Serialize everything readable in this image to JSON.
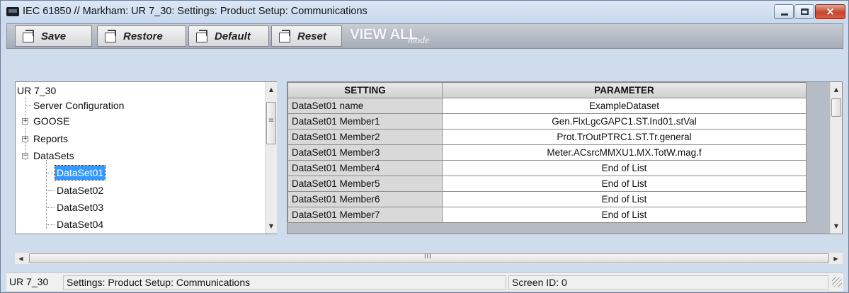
{
  "window": {
    "title": "IEC 61850 // Markham: UR 7_30: Settings: Product Setup: Communications",
    "close_glyph": "×"
  },
  "toolbar": {
    "save_label": "Save",
    "restore_label": "Restore",
    "default_label": "Default",
    "reset_label": "Reset",
    "view_all": "VIEW ALL",
    "view_all_mode": "mode"
  },
  "tree": {
    "root": "UR 7_30",
    "items": [
      {
        "label": "Server Configuration",
        "toggle": ""
      },
      {
        "label": "GOOSE",
        "toggle": "+"
      },
      {
        "label": "Reports",
        "toggle": "+"
      },
      {
        "label": "DataSets",
        "toggle": "−"
      },
      {
        "label": "DataSet01",
        "toggle": "",
        "selected": true
      },
      {
        "label": "DataSet02",
        "toggle": ""
      },
      {
        "label": "DataSet03",
        "toggle": ""
      },
      {
        "label": "DataSet04",
        "toggle": ""
      }
    ]
  },
  "grid": {
    "columns": [
      "SETTING",
      "PARAMETER"
    ],
    "rows": [
      {
        "setting": "DataSet01 name",
        "parameter": "ExampleDataset"
      },
      {
        "setting": "DataSet01 Member1",
        "parameter": "Gen.FlxLgcGAPC1.ST.Ind01.stVal"
      },
      {
        "setting": "DataSet01 Member2",
        "parameter": "Prot.TrOutPTRC1.ST.Tr.general"
      },
      {
        "setting": "DataSet01 Member3",
        "parameter": "Meter.ACsrcMMXU1.MX.TotW.mag.f"
      },
      {
        "setting": "DataSet01 Member4",
        "parameter": "End of List"
      },
      {
        "setting": "DataSet01 Member5",
        "parameter": "End of List"
      },
      {
        "setting": "DataSet01 Member6",
        "parameter": "End of List"
      },
      {
        "setting": "DataSet01 Member7",
        "parameter": "End of List"
      }
    ]
  },
  "scroll": {
    "up": "▲",
    "down": "▼",
    "left": "◀",
    "right": "▶",
    "grip": "III",
    "tree_grip": "≡"
  },
  "status": {
    "device": "UR 7_30",
    "path": "Settings: Product Setup: Communications",
    "screen_id": "Screen ID: 0"
  },
  "colors": {
    "selection": "#3399ff",
    "title_bar": "#cfdcec",
    "close_button": "#c7442d"
  }
}
